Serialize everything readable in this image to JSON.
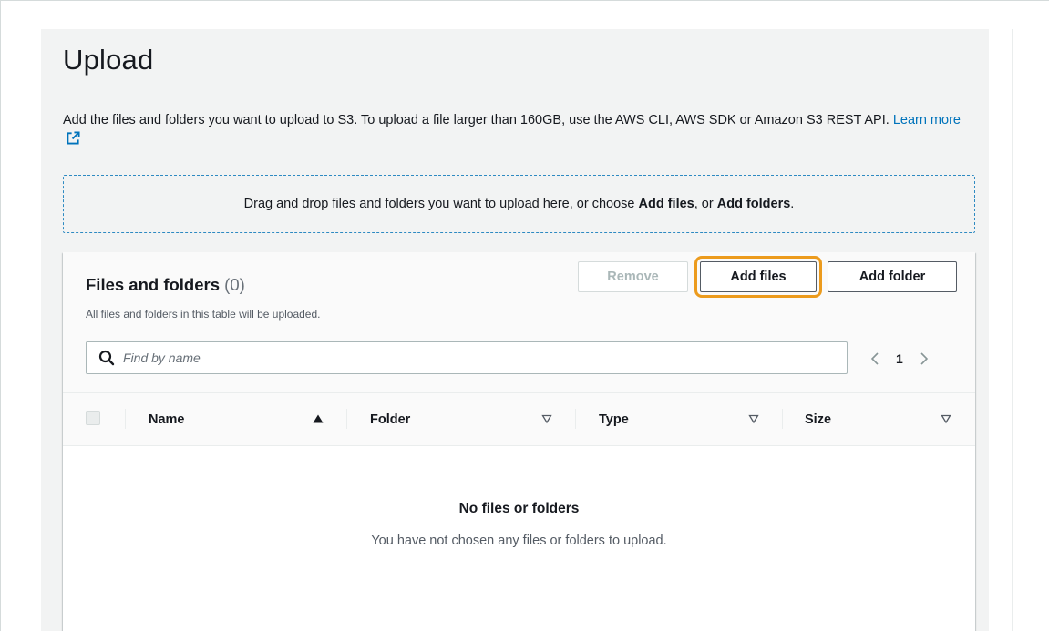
{
  "page": {
    "title": "Upload",
    "description": "Add the files and folders you want to upload to S3. To upload a file larger than 160GB, use the AWS CLI, AWS SDK or Amazon S3 REST API.",
    "learn_more_label": "Learn more",
    "external_link_icon": "external-link-icon"
  },
  "dropzone": {
    "text_before": "Drag and drop files and folders you want to upload here, or choose ",
    "add_files": "Add files",
    "text_middle": ", or ",
    "add_folders": "Add folders",
    "text_after": "."
  },
  "files_panel": {
    "title": "Files and folders",
    "count": "(0)",
    "subtitle": "All files and folders in this table will be uploaded.",
    "buttons": {
      "remove": "Remove",
      "add_files": "Add files",
      "add_folder": "Add folder"
    },
    "search": {
      "placeholder": "Find by name",
      "value": "",
      "icon": "search-icon"
    },
    "pagination": {
      "current_page": "1"
    },
    "columns": [
      {
        "label": "Name",
        "sort": "ascending"
      },
      {
        "label": "Folder",
        "sort": "none"
      },
      {
        "label": "Type",
        "sort": "none"
      },
      {
        "label": "Size",
        "sort": "none"
      }
    ],
    "empty_state": {
      "title": "No files or folders",
      "message": "You have not chosen any files or folders to upload."
    }
  },
  "colors": {
    "link": "#0073bb",
    "focus_ring": "#ec9b1d",
    "dropzone_border": "#2e8ac2"
  }
}
